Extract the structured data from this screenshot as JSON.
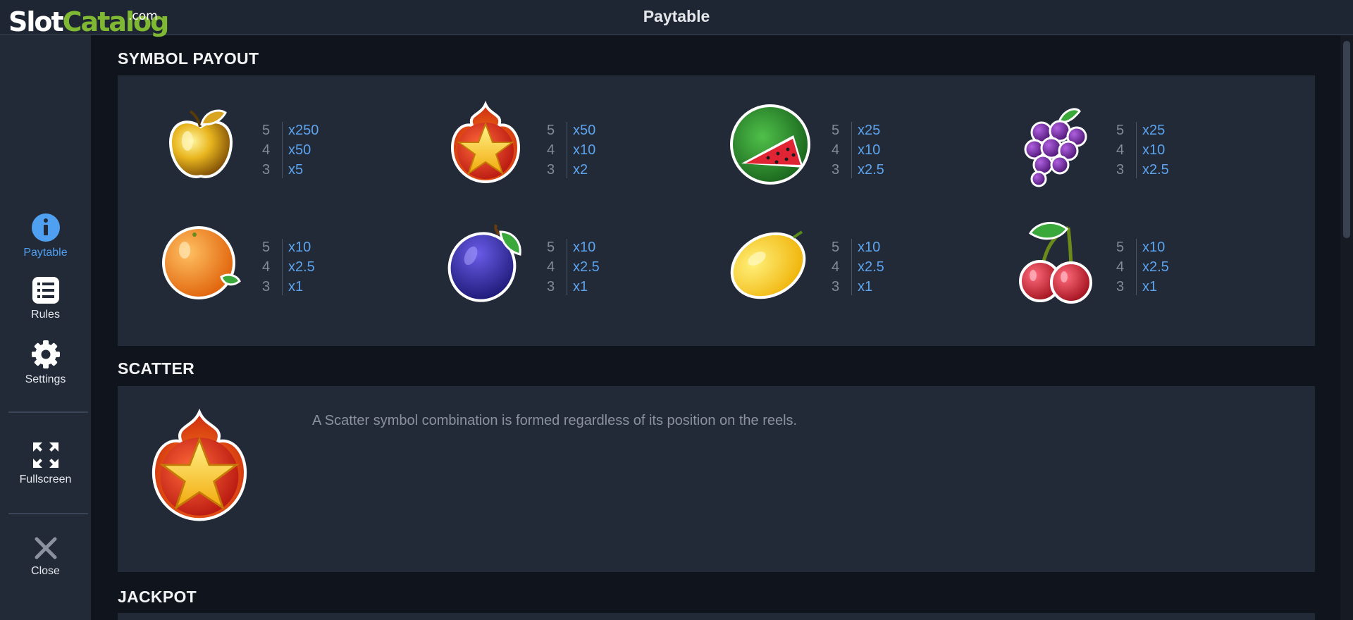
{
  "logo": {
    "slot": "Slot",
    "catalog": "Catalog",
    "dotcom": ".com"
  },
  "header": {
    "title": "Paytable"
  },
  "sidebar": {
    "items": [
      {
        "label": "Paytable",
        "icon": "info-icon",
        "active": true
      },
      {
        "label": "Rules",
        "icon": "list-icon",
        "active": false
      },
      {
        "label": "Settings",
        "icon": "gear-icon",
        "active": false
      },
      {
        "label": "Fullscreen",
        "icon": "fullscreen-icon",
        "active": false
      },
      {
        "label": "Close",
        "icon": "close-icon",
        "active": false
      }
    ]
  },
  "sections": {
    "symbol_payout": {
      "title": "SYMBOL PAYOUT",
      "symbols": [
        {
          "name": "golden-apple",
          "pays": [
            {
              "count": "5",
              "mult": "x250"
            },
            {
              "count": "4",
              "mult": "x50"
            },
            {
              "count": "3",
              "mult": "x5"
            }
          ]
        },
        {
          "name": "fire-star",
          "pays": [
            {
              "count": "5",
              "mult": "x50"
            },
            {
              "count": "4",
              "mult": "x10"
            },
            {
              "count": "3",
              "mult": "x2"
            }
          ]
        },
        {
          "name": "watermelon",
          "pays": [
            {
              "count": "5",
              "mult": "x25"
            },
            {
              "count": "4",
              "mult": "x10"
            },
            {
              "count": "3",
              "mult": "x2.5"
            }
          ]
        },
        {
          "name": "grapes",
          "pays": [
            {
              "count": "5",
              "mult": "x25"
            },
            {
              "count": "4",
              "mult": "x10"
            },
            {
              "count": "3",
              "mult": "x2.5"
            }
          ]
        },
        {
          "name": "orange",
          "pays": [
            {
              "count": "5",
              "mult": "x10"
            },
            {
              "count": "4",
              "mult": "x2.5"
            },
            {
              "count": "3",
              "mult": "x1"
            }
          ]
        },
        {
          "name": "plum",
          "pays": [
            {
              "count": "5",
              "mult": "x10"
            },
            {
              "count": "4",
              "mult": "x2.5"
            },
            {
              "count": "3",
              "mult": "x1"
            }
          ]
        },
        {
          "name": "lemon",
          "pays": [
            {
              "count": "5",
              "mult": "x10"
            },
            {
              "count": "4",
              "mult": "x2.5"
            },
            {
              "count": "3",
              "mult": "x1"
            }
          ]
        },
        {
          "name": "cherries",
          "pays": [
            {
              "count": "5",
              "mult": "x10"
            },
            {
              "count": "4",
              "mult": "x2.5"
            },
            {
              "count": "3",
              "mult": "x1"
            }
          ]
        }
      ]
    },
    "scatter": {
      "title": "SCATTER",
      "description": "A Scatter symbol combination is formed regardless of its position on the reels."
    },
    "jackpot": {
      "title": "JACKPOT"
    }
  },
  "colors": {
    "background": "#10141c",
    "panel": "#222a38",
    "accent": "#4fa0f0",
    "multiplier": "#5da4ee",
    "count": "#838b98",
    "logo_green": "#7fb832"
  }
}
